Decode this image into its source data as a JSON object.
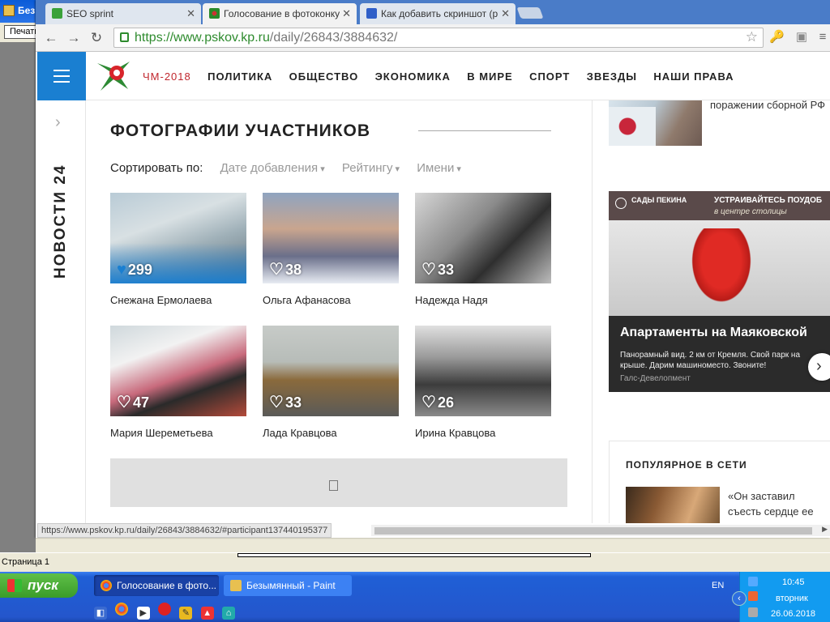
{
  "paint": {
    "window_title": "Безымянный - Paint",
    "print_label": "Печать",
    "status_page": "Страница 1"
  },
  "browser": {
    "tabs": [
      {
        "title": "SEO sprint",
        "active": false
      },
      {
        "title": "Голосование в фотоконкурс",
        "active": true
      },
      {
        "title": "Как добавить скриншот (р",
        "active": false
      }
    ],
    "url_domain": "https://www.pskov.kp.ru",
    "url_path": "/daily/26843/3884632/",
    "status_url": "https://www.pskov.kp.ru/daily/26843/3884632/#participant137440195377"
  },
  "site": {
    "nav": [
      "ЧМ-2018",
      "ПОЛИТИКА",
      "ОБЩЕСТВО",
      "ЭКОНОМИКА",
      "В МИРЕ",
      "СПОРТ",
      "ЗВЕЗДЫ",
      "НАШИ ПРАВА"
    ],
    "side_label": "НОВОСТИ 24",
    "section_title": "ФОТОГРАФИИ УЧАСТНИКОВ",
    "sort_label": "Сортировать по:",
    "sort_options": [
      "Дате добавления",
      "Рейтингу",
      "Имени"
    ],
    "participants": [
      {
        "name": "Снежана Ермолаева",
        "likes": "299",
        "liked": true
      },
      {
        "name": "Ольга Афанасова",
        "likes": "38",
        "liked": false
      },
      {
        "name": "Надежда Надя",
        "likes": "33",
        "liked": false
      },
      {
        "name": "Мария Шереметьева",
        "likes": "47",
        "liked": false
      },
      {
        "name": "Лада Кравцова",
        "likes": "33",
        "liked": false
      },
      {
        "name": "Ирина Кравцова",
        "likes": "26",
        "liked": false
      }
    ],
    "news_snippet": "поражении сборной РФ",
    "ad": {
      "brand": "САДЫ ПЕКИНА",
      "hook": "УСТРАИВАЙТЕСЬ ПОУДОБ",
      "hook_sub": "в центре столицы",
      "headline": "Апартаменты на Маяковской",
      "description": "Панорамный вид. 2 км от Кремля. Свой парк на крыше. Дарим машиноместо. Звоните!",
      "source": "Галс-Девелопмент"
    },
    "popular_title": "ПОПУЛЯРНОЕ В СЕТИ",
    "popular_line1": "«Он заставил",
    "popular_line2": "съесть сердце ее"
  },
  "taskbar": {
    "start_label": "пуск",
    "buttons": [
      {
        "label": "Голосование в фото...",
        "active": true
      },
      {
        "label": "Безымянный - Paint",
        "active": false
      }
    ],
    "lang": "EN",
    "time": "10:45",
    "day": "вторник",
    "date": "26.06.2018"
  }
}
